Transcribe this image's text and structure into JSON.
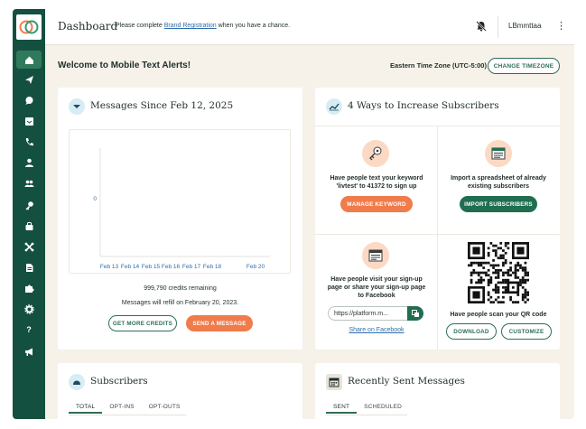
{
  "app": {
    "title": "Dashboard",
    "notice_prefix": "Please complete",
    "notice_link": "Brand Registration",
    "notice_suffix": "when you have a chance.",
    "user_name": "LBmmttaa"
  },
  "colors": {
    "sidebar": "#14503f",
    "accent_green": "#1f6e50",
    "accent_orange": "#f07b4b",
    "link": "#2f6ea8",
    "background": "#f6f2e9"
  },
  "sidebar": {
    "items": [
      {
        "icon": "home-icon",
        "active": true
      },
      {
        "icon": "send-icon",
        "active": false
      },
      {
        "icon": "chat-icon",
        "active": false
      },
      {
        "icon": "inbox-icon",
        "active": false
      },
      {
        "icon": "phone-icon",
        "active": false
      },
      {
        "icon": "person-icon",
        "active": false
      },
      {
        "icon": "group-icon",
        "active": false
      },
      {
        "icon": "key-icon",
        "active": false
      },
      {
        "icon": "bag-icon",
        "active": false
      },
      {
        "icon": "integrations-icon",
        "active": false
      },
      {
        "icon": "document-icon",
        "active": false
      },
      {
        "icon": "puzzle-icon",
        "active": false
      },
      {
        "icon": "gear-icon",
        "active": false
      },
      {
        "icon": "help-icon",
        "active": false,
        "label": "?"
      },
      {
        "icon": "megaphone-icon",
        "active": false
      }
    ]
  },
  "welcome": {
    "text": "Welcome to Mobile Text Alerts!",
    "timezone_label": "Eastern Time Zone (UTC-5:00)",
    "change_timezone": "CHANGE TIMEZONE"
  },
  "messages_card": {
    "title": "Messages Since Feb 12, 2025",
    "credits_text": "999,790 credits remaining",
    "refill_text": "Messages will refill on February 20, 2023.",
    "get_credits": "GET MORE CREDITS",
    "send_message": "SEND A MESSAGE"
  },
  "chart_data": {
    "type": "line",
    "categories": [
      "Feb 13",
      "Feb 14",
      "Feb 15",
      "Feb 16",
      "Feb 17",
      "Feb 18",
      "Feb 20"
    ],
    "yticks": [
      "0"
    ],
    "series": [
      {
        "values": [
          0,
          0,
          0,
          0,
          0,
          0,
          0
        ]
      }
    ],
    "ylim": [
      0,
      1
    ],
    "grid": false
  },
  "increase_card": {
    "title": "4 Ways to Increase Subscribers",
    "keyword": {
      "icon": "key-icon",
      "text": "Have people text your keyword 'livtest' to 41372 to sign up",
      "button": "MANAGE KEYWORD"
    },
    "import": {
      "icon": "spreadsheet-icon",
      "text": "Import a spreadsheet of already existing subscribers",
      "button": "IMPORT SUBSCRIBERS"
    },
    "signup": {
      "icon": "webpage-icon",
      "text": "Have people visit your sign-up page or share your sign-up page to Facebook",
      "url": "https://platform.m...",
      "share": "Share on Facebook"
    },
    "qr": {
      "icon": "qr-code-icon",
      "text": "Have people scan your QR code",
      "download": "DOWNLOAD",
      "customize": "CUSTOMIZE"
    }
  },
  "subscribers_card": {
    "title": "Subscribers",
    "tabs": [
      "TOTAL",
      "OPT-INS",
      "OPT-OUTS"
    ]
  },
  "recent_card": {
    "title": "Recently Sent Messages",
    "tabs": [
      "SENT",
      "SCHEDULED"
    ]
  }
}
